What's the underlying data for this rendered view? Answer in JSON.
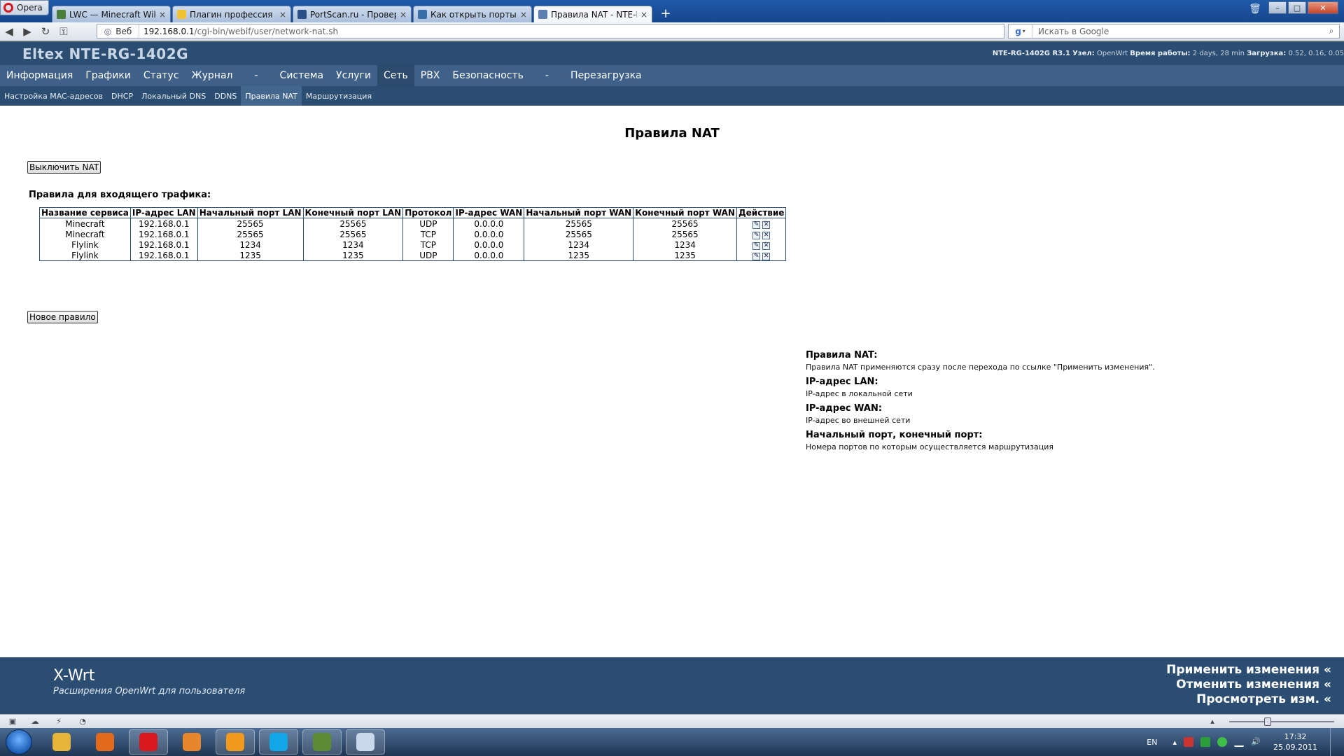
{
  "browser": {
    "opera_label": "Opera",
    "tabs": [
      {
        "label": "LWC — Minecraft Wiki",
        "color": "#4a7e3b"
      },
      {
        "label": "Плагин профессия - ...",
        "color": "#f1c232"
      },
      {
        "label": "PortScan.ru - Проверк...",
        "color": "#2c4f86"
      },
      {
        "label": "Как открыть порты дл...",
        "color": "#3a6ea8"
      },
      {
        "label": "Правила NAT - NTE-R...",
        "color": "#5a7fb0"
      }
    ],
    "tab_close": "×",
    "tab_add": "+",
    "address_label": "Веб",
    "url_host": "192.168.0.1",
    "url_path": "/cgi-bin/webif/user/network-nat.sh",
    "search_placeholder": "Искать в Google"
  },
  "router": {
    "title": "Eltex NTE-RG-1402G",
    "info": {
      "model": "NTE-RG-1402G R3.1",
      "node_label": "Узел:",
      "node": "OpenWrt",
      "uptime_label": "Время работы:",
      "uptime": "2 days, 28 min",
      "load_label": "Загрузка:",
      "load": "0.52, 0.16, 0.05"
    },
    "menu": [
      "Информация",
      "Графики",
      "Статус",
      "Журнал",
      "-",
      "Система",
      "Услуги",
      "Сеть",
      "PBX",
      "Безопасность",
      "-",
      "Перезагрузка"
    ],
    "active_menu": "Сеть",
    "submenu": [
      "Настройка MAC-адресов",
      "DHCP",
      "Локальный DNS",
      "DDNS",
      "Правила NAT",
      "Маршрутизация"
    ],
    "active_submenu": "Правила NAT"
  },
  "content": {
    "page_title": "Правила NAT",
    "disable_button": "Выключить NAT",
    "section_title": "Правила для входящего трафика:",
    "table": {
      "headers": [
        "Название сервиса",
        "IP-адрес LAN",
        "Начальный порт LAN",
        "Конечный порт LAN",
        "Протокол",
        "IP-адрес WAN",
        "Начальный порт WAN",
        "Конечный порт WAN",
        "Действие"
      ],
      "rows": [
        [
          "Minecraft",
          "192.168.0.1",
          "25565",
          "25565",
          "UDP",
          "0.0.0.0",
          "25565",
          "25565"
        ],
        [
          "Minecraft",
          "192.168.0.1",
          "25565",
          "25565",
          "TCP",
          "0.0.0.0",
          "25565",
          "25565"
        ],
        [
          "Flylink",
          "192.168.0.1",
          "1234",
          "1234",
          "TCP",
          "0.0.0.0",
          "1234",
          "1234"
        ],
        [
          "Flylink",
          "192.168.0.1",
          "1235",
          "1235",
          "UDP",
          "0.0.0.0",
          "1235",
          "1235"
        ]
      ]
    },
    "new_rule_button": "Новое правило",
    "help": [
      {
        "title": "Правила NAT:",
        "text": "Правила NAT применяются сразу после перехода по ссылке \"Применить изменения\"."
      },
      {
        "title": "IP-адрес LAN:",
        "text": "IP-адрес в локальной сети"
      },
      {
        "title": "IP-адрес WAN:",
        "text": "IP-адрес во внешней сети"
      },
      {
        "title": "Начальный порт, конечный порт:",
        "text": "Номера портов по которым осуществляется маршрутизация"
      }
    ]
  },
  "footer": {
    "brand": "X-Wrt",
    "tagline": "Расширения OpenWrt для пользователя",
    "links": [
      "Применить изменения «",
      "Отменить изменения «",
      "Просмотреть изм. «"
    ]
  },
  "taskbar": {
    "apps": [
      {
        "name": "explorer",
        "color": "#e7b43a",
        "open": false
      },
      {
        "name": "firefox",
        "color": "#e46a1b",
        "open": false
      },
      {
        "name": "opera",
        "color": "#d8171f",
        "open": true
      },
      {
        "name": "media-player",
        "color": "#e8862e",
        "open": false
      },
      {
        "name": "mail-agent",
        "color": "#f39a1e",
        "open": true
      },
      {
        "name": "skype",
        "color": "#12a5e8",
        "open": true
      },
      {
        "name": "minecraft",
        "color": "#5c8a35",
        "open": true
      },
      {
        "name": "paint",
        "color": "#c9d8ea",
        "open": true
      }
    ],
    "lang": "EN",
    "time": "17:32",
    "date": "25.09.2011"
  },
  "colors": {
    "header": "#2c4d72",
    "menu": "#3e6089",
    "accent": "#43668f"
  }
}
